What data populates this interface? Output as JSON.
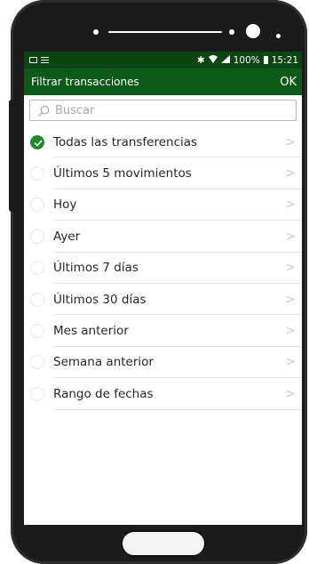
{
  "status_bar": {
    "percent": "100%",
    "time": "15:21",
    "icons": [
      "image-icon",
      "menu-icon",
      "bluetooth-icon",
      "wifi-icon",
      "signal-icon",
      "battery-icon"
    ]
  },
  "header": {
    "title": "Filtrar transacciones",
    "ok_label": "OK"
  },
  "search": {
    "placeholder": "Buscar"
  },
  "filters": [
    {
      "label": "Todas las transferencias",
      "selected": true
    },
    {
      "label": "Últimos 5 movimientos",
      "selected": false
    },
    {
      "label": "Hoy",
      "selected": false
    },
    {
      "label": "Ayer",
      "selected": false
    },
    {
      "label": "Últimos 7 días",
      "selected": false
    },
    {
      "label": "Últimos 30 días",
      "selected": false
    },
    {
      "label": "Mes anterior",
      "selected": false
    },
    {
      "label": "Semana anterior",
      "selected": false
    },
    {
      "label": "Rango de fechas",
      "selected": false
    }
  ],
  "colors": {
    "status_bar": "#0b4512",
    "app_bar": "#0d5a18",
    "accent_check": "#1f8a2c"
  }
}
